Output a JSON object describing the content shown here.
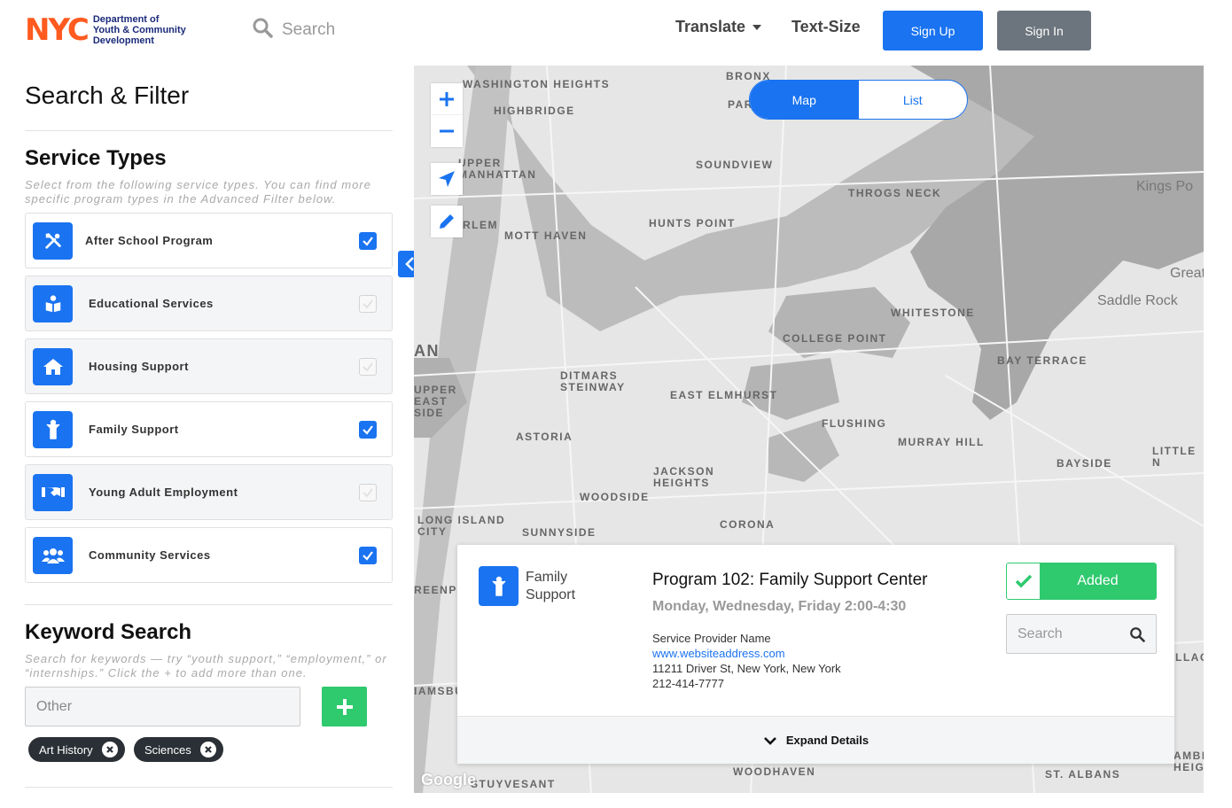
{
  "header": {
    "logo_text": "NYC",
    "department": [
      "Department of",
      "Youth & Community",
      "Development"
    ],
    "search_label": "Search",
    "translate_label": "Translate",
    "text_size_label": "Text-Size",
    "sign_up_label": "Sign Up",
    "sign_in_label": "Sign In"
  },
  "filter": {
    "title": "Search & Filter",
    "service_types": {
      "title": "Service Types",
      "hint": "Select from the following service types. You can find more specific program types in the Advanced Filter below.",
      "items": [
        {
          "label": "After School Program",
          "checked": true,
          "icon": "tools-icon"
        },
        {
          "label": "Educational Services",
          "checked": false,
          "icon": "book-reader-icon"
        },
        {
          "label": "Housing Support",
          "checked": false,
          "icon": "home-icon"
        },
        {
          "label": "Family Support",
          "checked": true,
          "icon": "child-icon"
        },
        {
          "label": "Young Adult Employment",
          "checked": false,
          "icon": "handshake-icon"
        },
        {
          "label": "Community Services",
          "checked": true,
          "icon": "users-icon"
        }
      ]
    },
    "keyword": {
      "title": "Keyword Search",
      "hint": "Search for keywords — try “youth support,” “employment,” or “internships.” Click the + to add more than one.",
      "placeholder": "Other",
      "tags": [
        "Art History",
        "Sciences"
      ]
    }
  },
  "map": {
    "toggle": {
      "map_label": "Map",
      "list_label": "List",
      "active": "Map"
    },
    "attribution": "Google",
    "labels": [
      "WASHINGTON HEIGHTS",
      "HIGHBRIDGE",
      "BRONX",
      "PAR",
      "UPPER MANHATTAN",
      "SOUNDVIEW",
      "THROGS NECK",
      "Kings Po",
      "RLEM",
      "MOTT HAVEN",
      "HUNTS POINT",
      "Great",
      "Saddle Rock",
      "WHITESTONE",
      "COLLEGE POINT",
      "BAY TERRACE",
      "AN",
      "DITMARS STEINWAY",
      "UPPER EAST SIDE",
      "EAST ELMHURST",
      "FLUSHING",
      "ASTORIA",
      "MURRAY HILL",
      "BAYSIDE",
      "LITTLE N",
      "JACKSON HEIGHTS",
      "WOODSIDE",
      "LONG ISLAND CITY",
      "SUNNYSIDE",
      "CORONA",
      "REENP",
      "IAMSBU",
      "LLAG",
      "STUYVESANT",
      "WOODHAVEN",
      "ST. ALBANS",
      "AMBI HEIGH"
    ],
    "colors": {
      "accent": "#1a73f0",
      "success": "#2fc96e"
    }
  },
  "program_card": {
    "category": "Family Support",
    "title": "Program 102: Family Support Center",
    "schedule": "Monday, Wednesday, Friday 2:00-4:30",
    "provider": "Service Provider Name",
    "website": "www.websiteaddress.com",
    "address": "11211 Driver St, New York, New York",
    "phone": "212-414-7777",
    "added_label": "Added",
    "search_placeholder": "Search",
    "expand_label": "Expand Details"
  }
}
